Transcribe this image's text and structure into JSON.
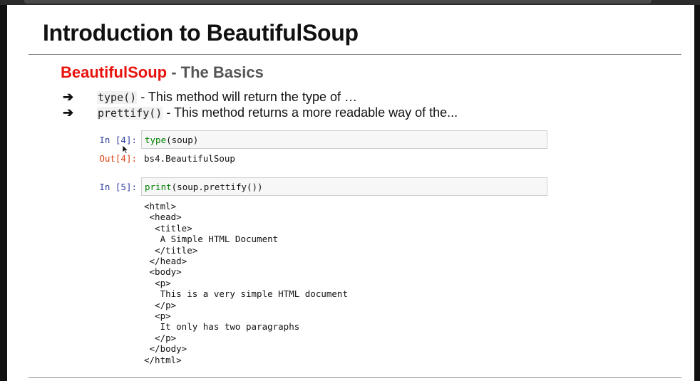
{
  "slide": {
    "title": "Introduction to BeautifulSoup",
    "subtitle_red": "BeautifulSoup",
    "subtitle_rest": " - The Basics"
  },
  "bullets": [
    {
      "code": "type()",
      "desc": " - This method will return the type of …"
    },
    {
      "code": "prettify()",
      "desc": " - This method returns a more readable way of the..."
    }
  ],
  "bullet_arrow": "➔",
  "cells": [
    {
      "in_prompt": "In [4]:",
      "code_fn": "type",
      "code_rest": "(soup)",
      "out_prompt": "Out[4]:",
      "output": "bs4.BeautifulSoup"
    },
    {
      "in_prompt": "In [5]:",
      "code_fn": "print",
      "code_rest": "(soup.prettify())",
      "output_lines": [
        "<html>",
        " <head>",
        "  <title>",
        "   A Simple HTML Document",
        "  </title>",
        " </head>",
        " <body>",
        "  <p>",
        "   This is a very simple HTML document",
        "  </p>",
        "  <p>",
        "   It only has two paragraphs",
        "  </p>",
        " </body>",
        "</html>"
      ]
    }
  ],
  "icons": {
    "cursor": "mouse-cursor-icon",
    "arrow": "right-arrow-icon"
  }
}
